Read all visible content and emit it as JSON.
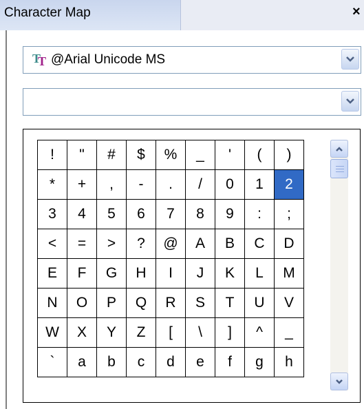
{
  "window": {
    "title": "Character Map",
    "close_glyph": "×"
  },
  "font_select": {
    "value": "@Arial Unicode MS",
    "icon": "truetype-font-icon"
  },
  "subset_select": {
    "value": ""
  },
  "grid": {
    "rows": [
      [
        "!",
        "\"",
        "#",
        "$",
        "%",
        "_",
        "'",
        "(",
        ")"
      ],
      [
        "*",
        "+",
        ",",
        "-",
        ".",
        "/",
        "0",
        "1",
        "2"
      ],
      [
        "3",
        "4",
        "5",
        "6",
        "7",
        "8",
        "9",
        ":",
        ";"
      ],
      [
        "<",
        "=",
        ">",
        "?",
        "@",
        "A",
        "B",
        "C",
        "D"
      ],
      [
        "E",
        "F",
        "G",
        "H",
        "I",
        "J",
        "K",
        "L",
        "M"
      ],
      [
        "N",
        "O",
        "P",
        "Q",
        "R",
        "S",
        "T",
        "U",
        "V"
      ],
      [
        "W",
        "X",
        "Y",
        "Z",
        "[",
        "\\",
        "]",
        "^",
        "_"
      ],
      [
        "`",
        "a",
        "b",
        "c",
        "d",
        "e",
        "f",
        "g",
        "h"
      ]
    ],
    "selected": "2"
  },
  "colors": {
    "selection": "#316ac5"
  }
}
